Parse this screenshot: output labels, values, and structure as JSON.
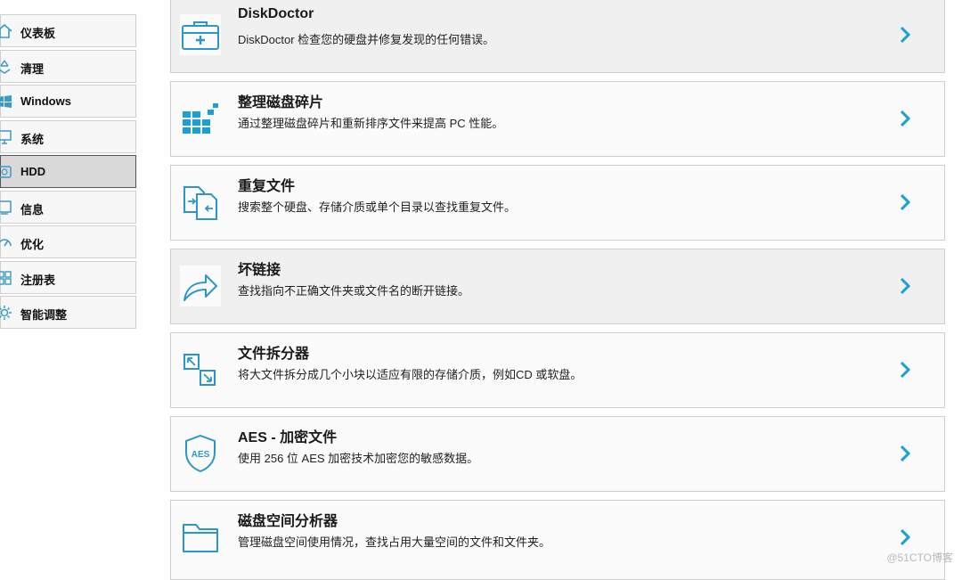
{
  "sidebar": {
    "items": [
      {
        "label": "仪表板",
        "icon": "dashboard-icon"
      },
      {
        "label": "清理",
        "icon": "recycle-icon"
      },
      {
        "label": "Windows",
        "icon": "windows-icon"
      },
      {
        "label": "系统",
        "icon": "computer-icon"
      },
      {
        "label": "HDD",
        "icon": "hard-drive-icon",
        "active": true
      },
      {
        "label": "信息",
        "icon": "info-icon"
      },
      {
        "label": "优化",
        "icon": "speedometer-icon"
      },
      {
        "label": "注册表",
        "icon": "registry-icon"
      },
      {
        "label": "智能调整",
        "icon": "gear-icon"
      }
    ]
  },
  "tools": [
    {
      "title": "DiskDoctor",
      "desc": "DiskDoctor 检查您的硬盘并修复发现的任何错误。",
      "icon": "first-aid-kit-icon"
    },
    {
      "title": "整理磁盘碎片",
      "desc": "通过整理磁盘碎片和重新排序文件来提高 PC 性能。",
      "icon": "defrag-blocks-icon"
    },
    {
      "title": "重复文件",
      "desc": "搜索整个硬盘、存储介质或单个目录以查找重复文件。",
      "icon": "duplicate-files-icon"
    },
    {
      "title": "坏链接",
      "desc": "查找指向不正确文件夹或文件名的断开链接。",
      "icon": "broken-link-arrow-icon"
    },
    {
      "title": "文件拆分器",
      "desc": "将大文件拆分成几个小块以适应有限的存储介质，例如CD 或软盘。",
      "icon": "file-splitter-icon"
    },
    {
      "title": "AES - 加密文件",
      "desc": "使用 256 位 AES 加密技术加密您的敏感数据。",
      "icon": "aes-shield-icon"
    },
    {
      "title": "磁盘空间分析器",
      "desc": "管理磁盘空间使用情况，查找占用大量空间的文件和文件夹。",
      "icon": "folder-icon"
    }
  ],
  "watermark": "@51CTO博客",
  "colors": {
    "accent": "#1a9fd6",
    "icon": "#3a9bc6"
  }
}
